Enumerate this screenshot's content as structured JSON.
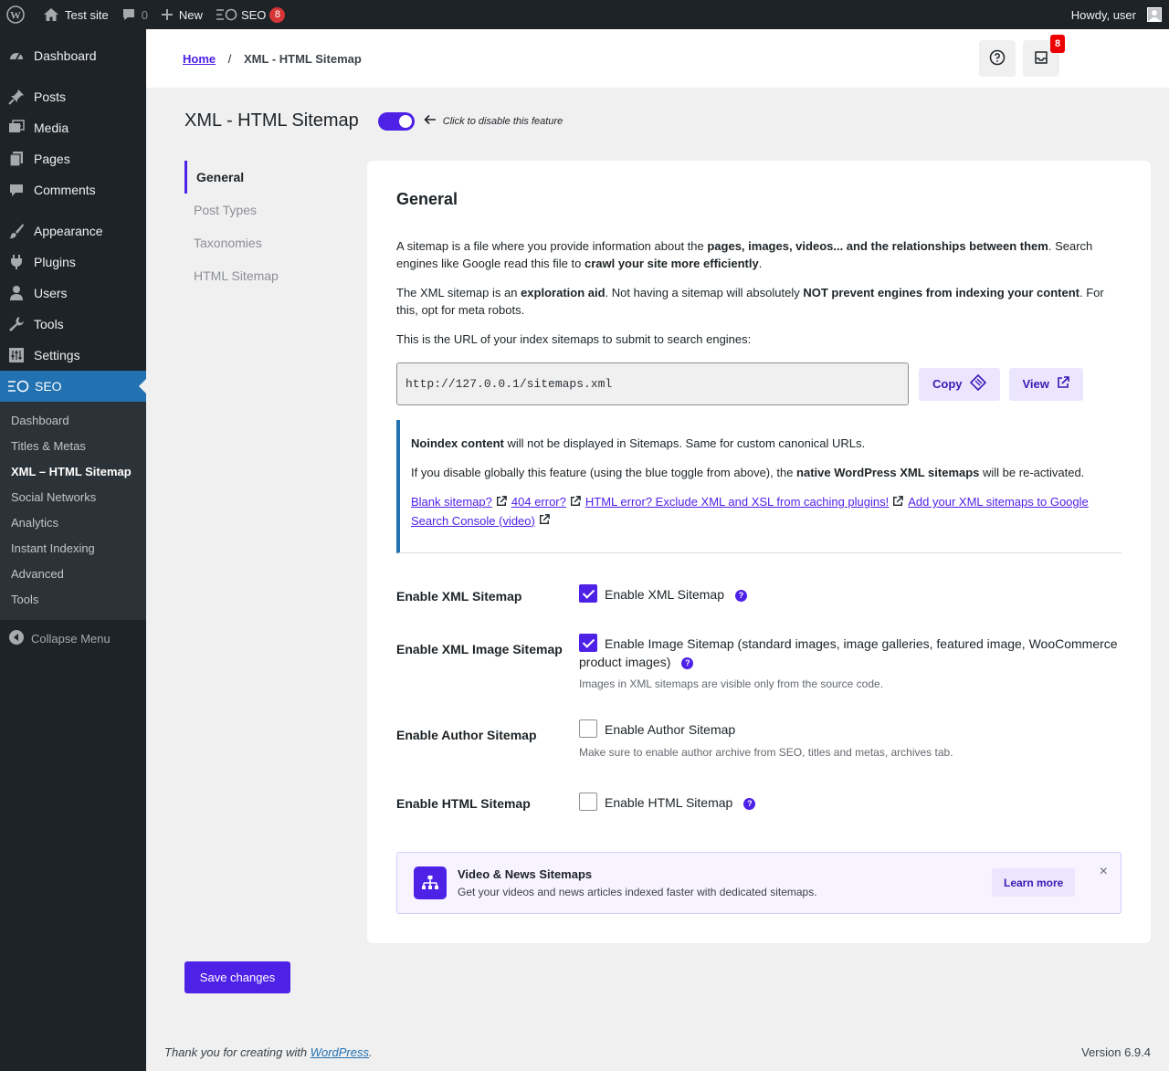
{
  "adminbar": {
    "site_name": "Test site",
    "comments_count": "0",
    "new_label": "New",
    "seo_label": "SEO",
    "seo_badge": "8",
    "howdy": "Howdy, user"
  },
  "menu": {
    "items": [
      {
        "label": "Dashboard",
        "icon": "dashboard-icon"
      },
      {
        "label": "Posts",
        "icon": "pin-icon"
      },
      {
        "label": "Media",
        "icon": "media-icon"
      },
      {
        "label": "Pages",
        "icon": "pages-icon"
      },
      {
        "label": "Comments",
        "icon": "comment-icon"
      },
      {
        "label": "Appearance",
        "icon": "brush-icon"
      },
      {
        "label": "Plugins",
        "icon": "plug-icon"
      },
      {
        "label": "Users",
        "icon": "user-icon"
      },
      {
        "label": "Tools",
        "icon": "wrench-icon"
      },
      {
        "label": "Settings",
        "icon": "sliders-icon"
      },
      {
        "label": "SEO",
        "icon": "seo-icon"
      }
    ],
    "submenu": [
      "Dashboard",
      "Titles & Metas",
      "XML – HTML Sitemap",
      "Social Networks",
      "Analytics",
      "Instant Indexing",
      "Advanced",
      "Tools"
    ],
    "collapse": "Collapse Menu"
  },
  "topbar": {
    "home": "Home",
    "separator": "/",
    "current": "XML - HTML Sitemap",
    "notif_badge": "8"
  },
  "header": {
    "title": "XML - HTML Sitemap",
    "toggle_hint": "Click to disable this feature"
  },
  "tabs": [
    "General",
    "Post Types",
    "Taxonomies",
    "HTML Sitemap"
  ],
  "panel": {
    "title": "General",
    "p1": {
      "a": "A sitemap is a file where you provide information about the ",
      "b": "pages, images, videos... and the relationships between them",
      "c": ". Search engines like Google read this file to ",
      "d": "crawl your site more efficiently",
      "e": "."
    },
    "p2": {
      "a": "The XML sitemap is an ",
      "b": "exploration aid",
      "c": ". Not having a sitemap will absolutely ",
      "d": "NOT prevent engines from indexing your content",
      "e": ". For this, opt for meta robots."
    },
    "p3": "This is the URL of your index sitemaps to submit to search engines:",
    "sitemap_url": "http://127.0.0.1/sitemaps.xml",
    "copy_label": "Copy",
    "view_label": "View",
    "notice": {
      "n1_bold": "Noindex content",
      "n1_rest": " will not be displayed in Sitemaps. Same for custom canonical URLs.",
      "n2_a": "If you disable globally this feature (using the blue toggle from above), the ",
      "n2_b": "native WordPress XML sitemaps",
      "n2_c": " will be re-activated.",
      "links": [
        "Blank sitemap?",
        "404 error?",
        "HTML error? Exclude XML and XSL from caching plugins!",
        "Add your XML sitemaps to Google Search Console (video)"
      ]
    },
    "settings": [
      {
        "label": "Enable XML Sitemap",
        "option": "Enable XML Sitemap",
        "checked": true,
        "help": true,
        "desc": ""
      },
      {
        "label": "Enable XML Image Sitemap",
        "option": "Enable Image Sitemap (standard images, image galleries, featured image, WooCommerce product images)",
        "checked": true,
        "help": true,
        "desc": "Images in XML sitemaps are visible only from the source code."
      },
      {
        "label": "Enable Author Sitemap",
        "option": "Enable Author Sitemap",
        "checked": false,
        "help": false,
        "desc": "Make sure to enable author archive from SEO, titles and metas, archives tab."
      },
      {
        "label": "Enable HTML Sitemap",
        "option": "Enable HTML Sitemap",
        "checked": false,
        "help": true,
        "desc": ""
      }
    ],
    "promo": {
      "title": "Video & News Sitemaps",
      "desc": "Get your videos and news articles indexed faster with dedicated sitemaps.",
      "button": "Learn more",
      "close": "×"
    }
  },
  "save_label": "Save changes",
  "footer": {
    "thanks_a": "Thank you for creating with ",
    "thanks_link": "WordPress",
    "thanks_b": ".",
    "version": "Version 6.9.4"
  },
  "colors": {
    "accent": "#4e21e7",
    "wp_blue": "#2271b1",
    "admin_dark": "#1d2327",
    "badge_red": "#d63638"
  }
}
